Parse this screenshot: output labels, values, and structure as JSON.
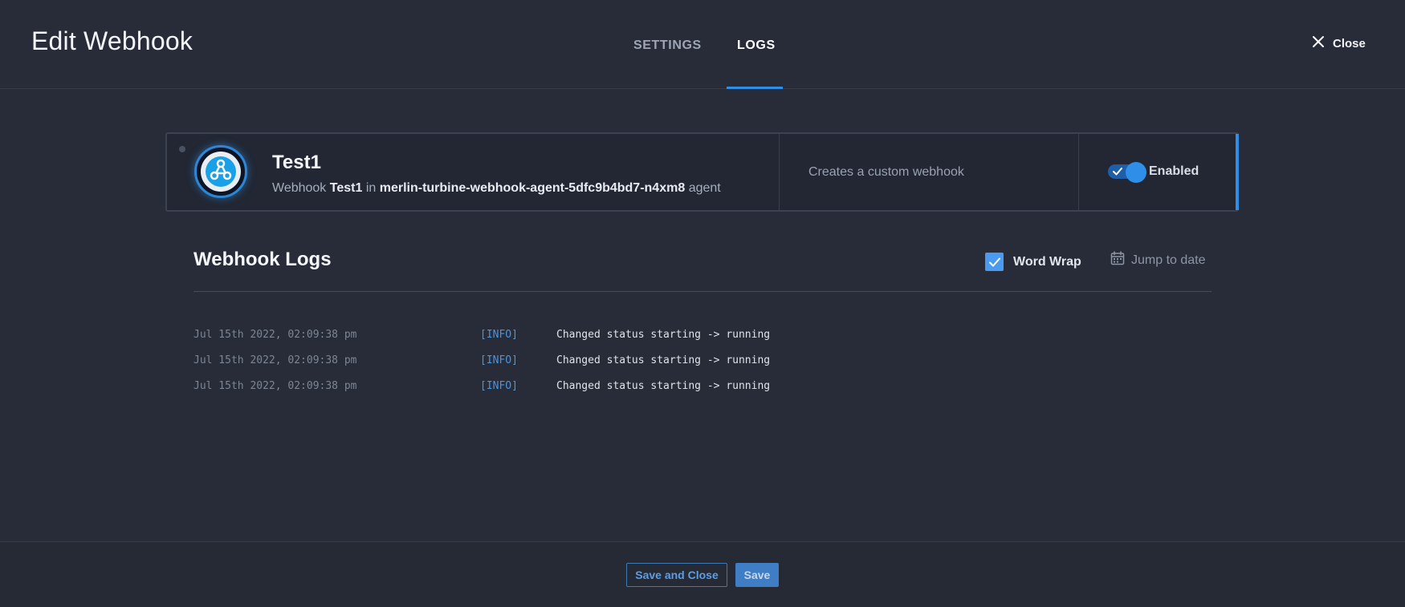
{
  "header": {
    "title": "Edit Webhook",
    "tabs": [
      {
        "label": "SETTINGS",
        "active": false
      },
      {
        "label": "LOGS",
        "active": true
      }
    ],
    "close_label": "Close"
  },
  "webhook": {
    "name": "Test1",
    "sub_prefix": "Webhook",
    "sub_name": "Test1",
    "sub_in": "in",
    "agent_name": "merlin-turbine-webhook-agent-5dfc9b4bd7-n4xm8",
    "sub_suffix": "agent",
    "description": "Creates a custom webhook",
    "enabled": true,
    "toggle_label": "Enabled",
    "icon": "webhook-icon"
  },
  "logs": {
    "title": "Webhook Logs",
    "word_wrap_label": "Word Wrap",
    "word_wrap_checked": true,
    "jump_label": "Jump to date",
    "entries": [
      {
        "time": "Jul 15th 2022, 02:09:38 pm",
        "level": "[INFO]",
        "message": "Changed status starting -> running"
      },
      {
        "time": "Jul 15th 2022, 02:09:38 pm",
        "level": "[INFO]",
        "message": "Changed status starting -> running"
      },
      {
        "time": "Jul 15th 2022, 02:09:38 pm",
        "level": "[INFO]",
        "message": "Changed status starting -> running"
      }
    ]
  },
  "footer": {
    "save_close_label": "Save and Close",
    "save_label": "Save"
  },
  "colors": {
    "background": "#272c38",
    "accent": "#2f8ee8",
    "info_level": "#4a94e0"
  }
}
